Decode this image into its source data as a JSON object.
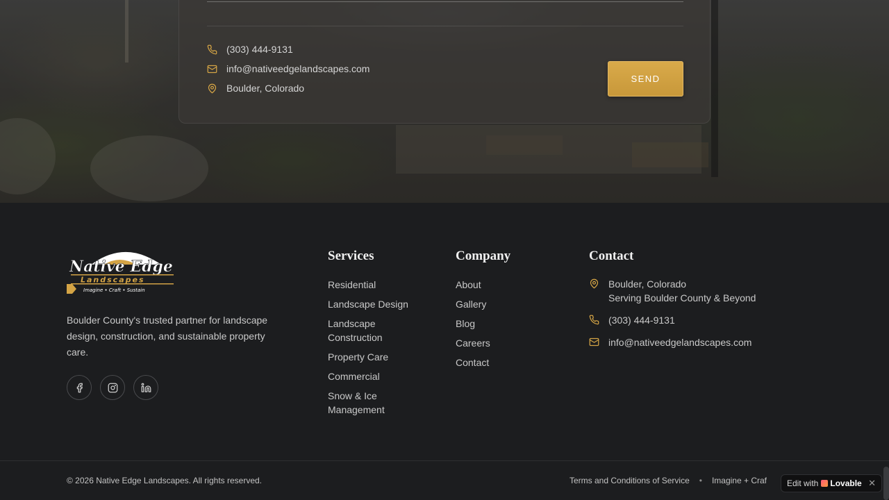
{
  "contact_card": {
    "phone": "(303) 444-9131",
    "email": "info@nativeedgelandscapes.com",
    "location": "Boulder, Colorado",
    "send_label": "SEND"
  },
  "brand": {
    "logo_line1": "Native Edge",
    "logo_line2": "Landscapes",
    "logo_tagline": "Imagine • Craft • Sustain",
    "description": "Boulder County's trusted partner for landscape design, construction, and sustainable property care."
  },
  "socials": [
    {
      "icon": "facebook-icon"
    },
    {
      "icon": "instagram-icon"
    },
    {
      "icon": "linkedin-icon"
    }
  ],
  "services": {
    "title": "Services",
    "items": [
      "Residential",
      "Landscape Design",
      "Landscape Construction",
      "Property Care",
      "Commercial",
      "Snow & Ice Management"
    ]
  },
  "company": {
    "title": "Company",
    "items": [
      "About",
      "Gallery",
      "Blog",
      "Careers",
      "Contact"
    ]
  },
  "contact": {
    "title": "Contact",
    "address_line1": "Boulder, Colorado",
    "address_line2": "Serving Boulder County & Beyond",
    "phone": "(303) 444-9131",
    "email": "info@nativeedgelandscapes.com"
  },
  "footer": {
    "copyright": "© 2026 Native Edge Landscapes. All rights reserved.",
    "terms": "Terms and Conditions of Service",
    "separator": "•",
    "slogan": "Imagine + Craf"
  },
  "lovable_badge": {
    "prefix": "Edit with",
    "brand": "Lovable",
    "close": "✕"
  },
  "colors": {
    "accent_gold": "#d4a445",
    "footer_bg": "#1c1d1f"
  }
}
